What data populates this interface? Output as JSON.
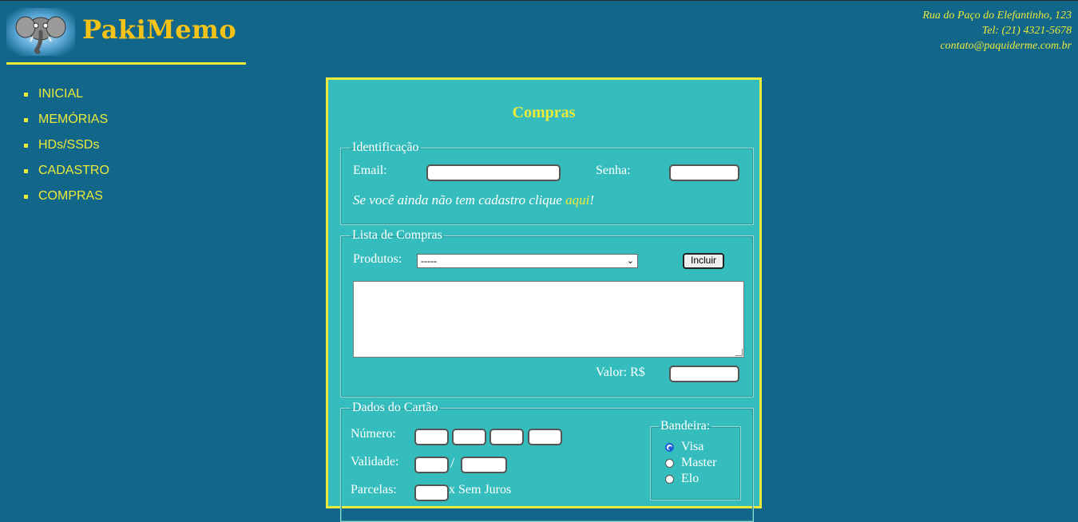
{
  "brand": {
    "name": "PakiMemo",
    "logo_icon": "elephant-logo"
  },
  "contact": {
    "address": "Rua do Paço do Elefantinho, 123",
    "phone": "Tel: (21) 4321-5678",
    "email": "contato@paquiderme.com.br"
  },
  "nav": [
    "INICIAL",
    "MEMÓRIAS",
    "HDs/SSDs",
    "CADASTRO",
    "COMPRAS"
  ],
  "page": {
    "title": "Compras"
  },
  "identificacao": {
    "legend": "Identificação",
    "email_label": "Email:",
    "senha_label": "Senha:",
    "note_text": "Se você ainda não tem cadastro clique ",
    "note_link": "aqui",
    "note_end": "!"
  },
  "lista": {
    "legend": "Lista de Compras",
    "produtos_label": "Produtos:",
    "produtos_selected": "-----",
    "incluir_button": "Incluir",
    "valor_label": "Valor: R$"
  },
  "cartao": {
    "legend": "Dados do Cartão",
    "numero_label": "Número:",
    "validade_label": "Validade:",
    "separator": "/",
    "parcelas_label": "Parcelas:",
    "parcelas_suffix": "x Sem Juros",
    "bandeira": {
      "legend": "Bandeira:",
      "options": [
        "Visa",
        "Master",
        "Elo"
      ],
      "selected": "Visa"
    }
  },
  "colors": {
    "background": "#11668a",
    "panel": "#35bcbc",
    "accent": "#ecea3a",
    "brand": "#f5c218"
  }
}
